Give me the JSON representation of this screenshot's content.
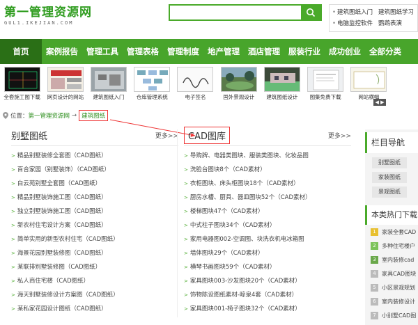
{
  "site": {
    "name": "第一管理资源网",
    "domain": "GUL1.IKEJIAN.COM"
  },
  "search": {
    "placeholder": "",
    "value": ""
  },
  "hot_links": [
    [
      "建筑图纸入门",
      "建筑图纸学习"
    ],
    [
      "电脑监控软件",
      "鹦鹉表演"
    ]
  ],
  "nav": [
    "首页",
    "案例报告",
    "管理工具",
    "管理表格",
    "管理制度",
    "地产管理",
    "酒店管理",
    "服装行业",
    "成功创业",
    "全部分类"
  ],
  "thumbs": [
    "全套施工图下载",
    "网页设计的网站",
    "建筑图纸入门",
    "仓库管理系统",
    "电子签名",
    "国外景观设计",
    "建筑图纸设计",
    "图集免费下载",
    "网站横幅"
  ],
  "thumb_nav": "◀ ▶",
  "breadcrumb": {
    "label": "位置：",
    "home": "第一管理资源网",
    "sep": "→",
    "current": "建筑图纸"
  },
  "left_col": {
    "title": "别墅图纸",
    "more": "更多>>",
    "items": [
      "精品别墅装修全套图（CAD图纸）",
      "百合家园（别墅装饰）（CAD图纸）",
      "白云苑别墅全套图（CAD图纸）",
      "精品别墅装饰施工图（CAD图纸）",
      "独立别墅装饰施工图（CAD图纸）",
      "新农村住宅设计方案（CAD图纸）",
      "简单实用的新型农村住宅（CAD图纸）",
      "海景花园别墅装修图（CAD图纸）",
      "某联排别墅装修图（CAD图纸）",
      "私人商住宅楼（CAD图纸）",
      "海天别墅装修设计方案图（CAD图纸）",
      "某私家花园设计图纸（CAD图纸）"
    ]
  },
  "mid_col": {
    "title": "CAD图库",
    "more": "更多>>",
    "items": [
      "导购牌、电器类图块、服装类图块、化妆品图",
      "洗脸台图块8个（CAD素材）",
      "衣柜图块、床头柜图块18个（CAD素材）",
      "厨房水槽、厨具、器皿图块52个（CAD素材）",
      "楼梯图块47个（CAD素材）",
      "中式柱子图块34个（CAD素材）",
      "家用电器图002-空调图、块洗衣机电冰箱图",
      "墙体图块29个（CAD素材）",
      "横琴书画图块59个（CAD素材）",
      "家具图块003-沙发图块20个（CAD素材）",
      "饰物陈设图纸素材-晾泉4套（CAD素材）",
      "家具图块001-椅子图块32个（CAD素材）"
    ]
  },
  "sidebar": {
    "title": "栏目导航",
    "tags": [
      "别墅图纸",
      "家装图纸",
      "景观图纸"
    ],
    "hot_title": "本类热门下载",
    "hot_items": [
      "家装全套CAD",
      "多种住宅楼户",
      "室内装修cad",
      "家具CAD图块",
      "小区景观规划",
      "室内装修设计",
      "小别墅CAD图"
    ]
  },
  "colors": {
    "brand_green": "#48a52b",
    "home_dark": "#2a6f16",
    "highlight_red": "#e33333"
  }
}
